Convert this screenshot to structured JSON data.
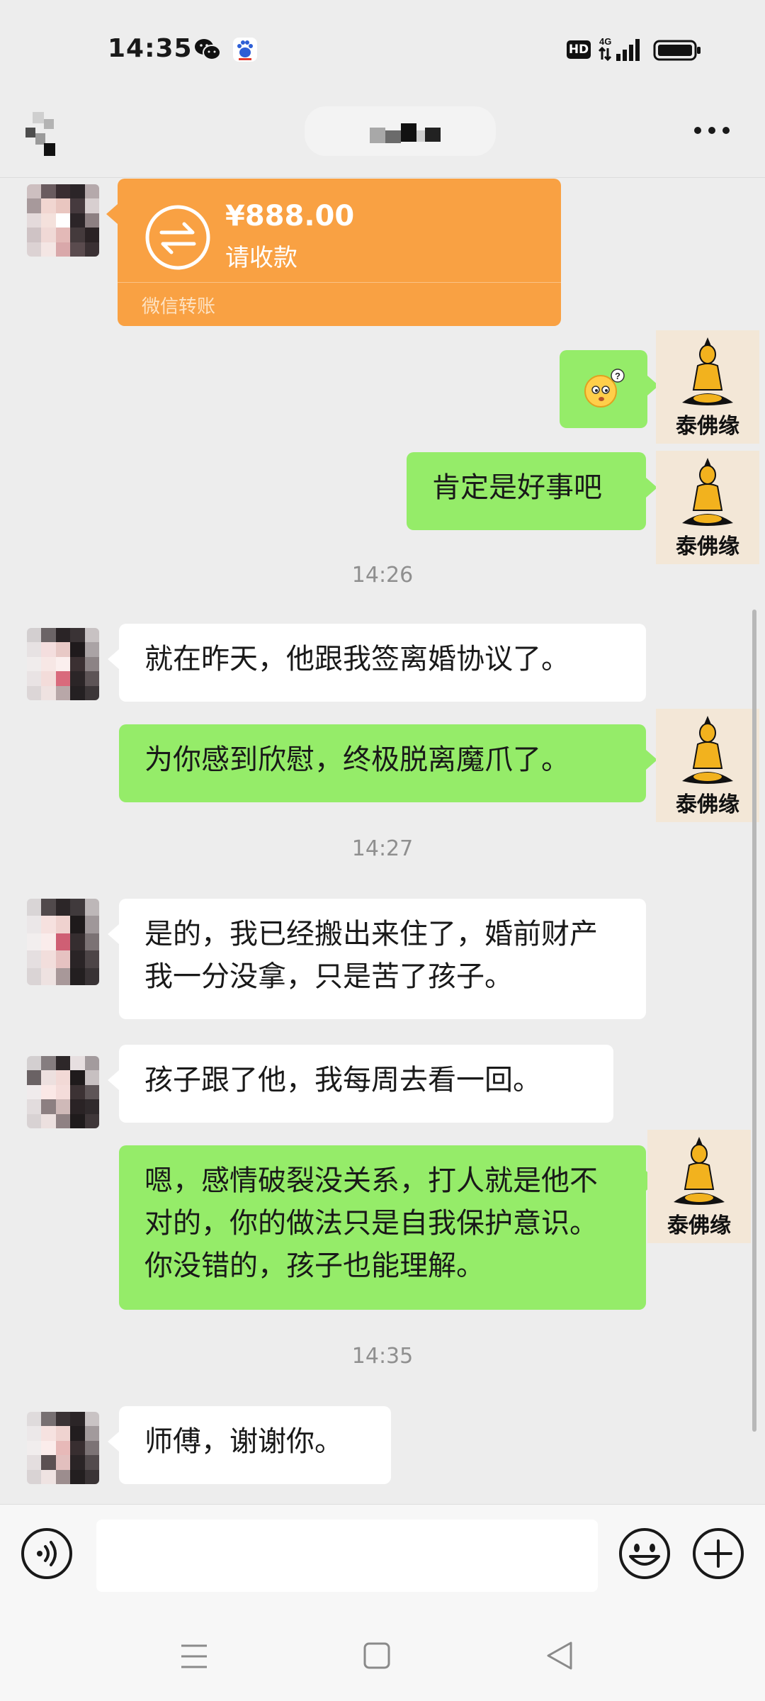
{
  "status_bar": {
    "time": "14:35",
    "hd_badge": "HD",
    "network": "4G",
    "icons": [
      "wechat-icon",
      "baidu-icon",
      "signal-icon",
      "battery-icon"
    ]
  },
  "header": {
    "more_label": "···"
  },
  "messages": {
    "transfer": {
      "amount": "¥888.00",
      "action": "请收款",
      "footer": "微信转账"
    },
    "m1": "肯定是好事吧",
    "ts1": "14:26",
    "m2": "就在昨天，他跟我签离婚协议了。",
    "m3": "为你感到欣慰，终极脱离魔爪了。",
    "ts2": "14:27",
    "m4": "是的，我已经搬出来住了，婚前财产我一分没拿，只是苦了孩子。",
    "m5": "孩子跟了他，我每周去看一回。",
    "m6": "嗯，感情破裂没关系，打人就是他不对的，你的做法只是自我保护意识。你没错的，孩子也能理解。",
    "ts3": "14:35",
    "m7": "师傅，谢谢你。"
  },
  "self_avatar": {
    "brand": "泰佛缘"
  },
  "input": {
    "placeholder": ""
  },
  "colors": {
    "background": "#ededed",
    "self_bubble": "#95ec69",
    "peer_bubble": "#ffffff",
    "transfer_card": "#f9a143"
  }
}
